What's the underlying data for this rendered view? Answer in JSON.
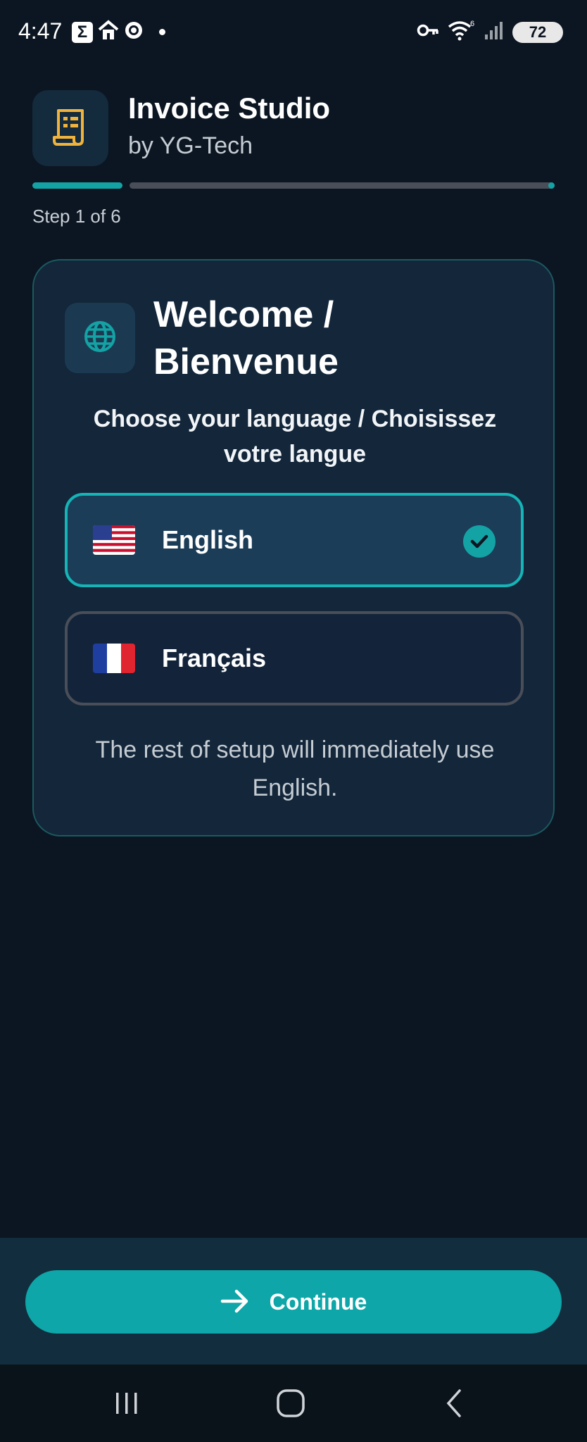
{
  "status_bar": {
    "time": "4:47",
    "left_icons": [
      "sigma-icon",
      "home-icon",
      "globe-app-icon"
    ],
    "battery": "72",
    "wifi_label": "6"
  },
  "header": {
    "app_title": "Invoice Studio",
    "app_subtitle": "by YG-Tech",
    "logo_icon": "receipt-icon",
    "logo_color": "#f0b43c"
  },
  "progress": {
    "step_label": "Step 1 of 6",
    "current_step": 1,
    "total_steps": 6
  },
  "card": {
    "title": "Welcome / Bienvenue",
    "subtitle": "Choose your language / Choisissez votre langue",
    "note": "The rest of setup will immediately use English.",
    "languages": [
      {
        "flag": "us-flag",
        "label": "English",
        "selected": true
      },
      {
        "flag": "fr-flag",
        "label": "Français",
        "selected": false
      }
    ]
  },
  "footer": {
    "continue_label": "Continue"
  },
  "colors": {
    "accent": "#14a3a5",
    "background": "#0c1622",
    "card": "#13263a"
  }
}
